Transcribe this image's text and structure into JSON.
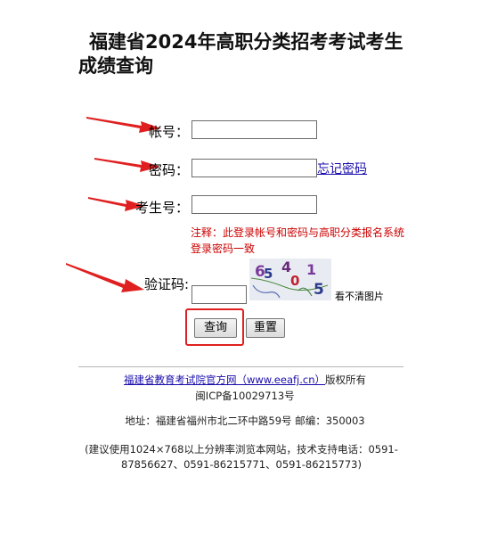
{
  "page": {
    "title_line1": "福建省2024年高职分类招考考试考生",
    "title_line2": "成绩查询"
  },
  "form": {
    "account_label": "帐号：",
    "password_label": "密码：",
    "candidate_label": "考生号：",
    "captcha_label": "验证码:",
    "forgot_password": "忘记密码",
    "note": "注释：此登录帐号和密码与高职分类报名系统登录密码一致",
    "captcha_text": "654015",
    "captcha_help": "看不清图片",
    "account_value": "",
    "password_value": "",
    "candidate_value": "",
    "captcha_value": ""
  },
  "buttons": {
    "query": "查询",
    "reset": "重置"
  },
  "footer": {
    "org_link": "福建省教育考试院官方网（www.eeafj.cn）",
    "rights": "版权所有",
    "icp": "闽ICP备10029713号",
    "address": "地址：福建省福州市北二环中路59号 邮编：350003",
    "support": "(建议使用1024×768以上分辨率浏览本网站，技术支持电话：0591-87856627、0591-86215771、0591-86215773)"
  },
  "colors": {
    "arrow": "#e02020",
    "note": "#cc0000",
    "link": "#1a0dab",
    "highlight_box": "#e02020"
  }
}
